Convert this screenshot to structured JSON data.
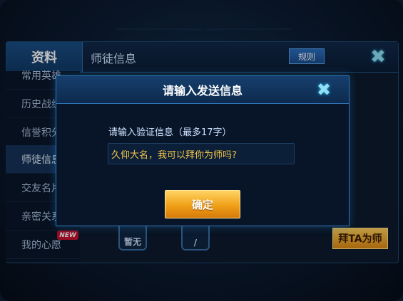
{
  "panel": {
    "tab_label": "资料",
    "title": "师徒信息",
    "rules_label": "规则"
  },
  "sidebar": {
    "items": [
      {
        "label": "常用英雄"
      },
      {
        "label": "历史战绩"
      },
      {
        "label": "信誉积分"
      },
      {
        "label": "师徒信息"
      },
      {
        "label": "交友名片"
      },
      {
        "label": "亲密关系"
      },
      {
        "label": "我的心愿"
      }
    ],
    "new_badge": "NEW",
    "selected_index": 3
  },
  "content": {
    "slots": [
      {
        "label": "暂无"
      },
      {
        "label": "/"
      }
    ],
    "apprentice_button": "拜TA为师"
  },
  "modal": {
    "title": "请输入发送信息",
    "prompt": "请输入验证信息（最多17字）",
    "input_value": "久仰大名，我可以拜你为师吗?",
    "confirm_label": "确定"
  },
  "colors": {
    "accent_gold": "#f0a018",
    "input_text": "#f0c24a",
    "panel_border": "#2f77b8",
    "new_badge": "#c8102e"
  },
  "icons": {
    "close": "close-x-icon"
  }
}
